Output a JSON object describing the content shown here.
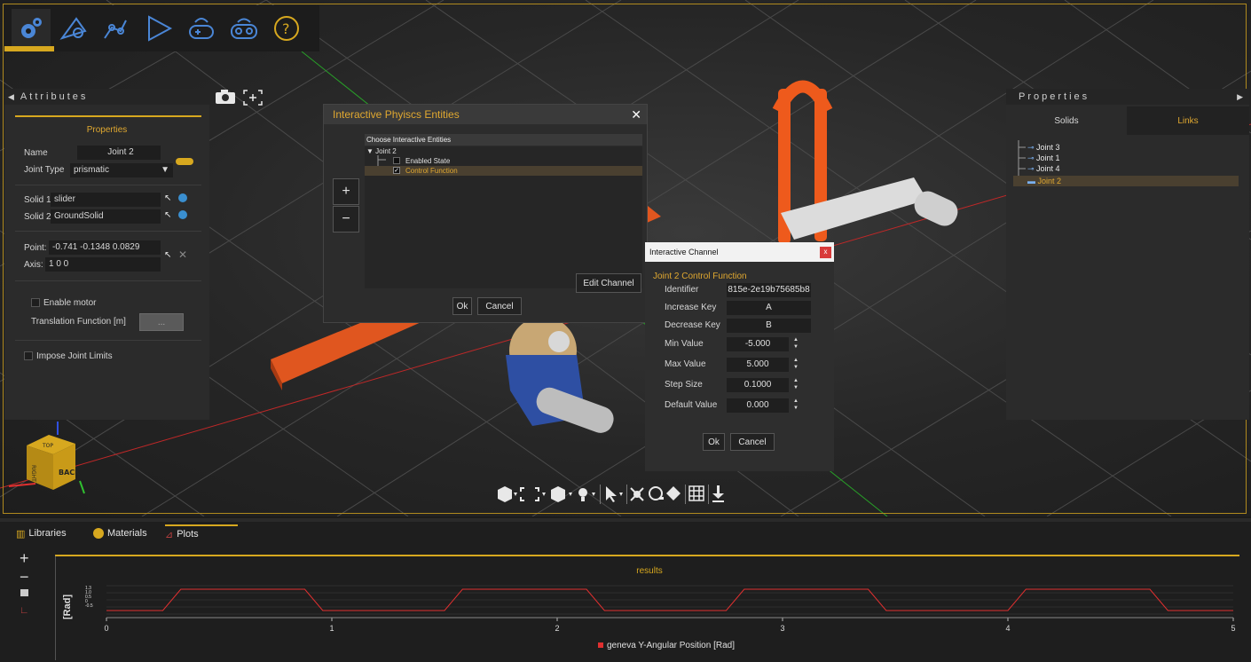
{
  "toolbar": {
    "items": [
      "settings-icon",
      "joint-icon",
      "robot-arm-icon",
      "play-icon",
      "gamepad-icon",
      "vr-controller-icon",
      "help-icon"
    ]
  },
  "attributes": {
    "header": "Attributes",
    "section_title": "Properties",
    "name_label": "Name",
    "name_value": "Joint 2",
    "joint_type_label": "Joint Type",
    "joint_type_value": "prismatic",
    "solid1_label": "Solid 1",
    "solid1_value": "slider",
    "solid2_label": "Solid 2",
    "solid2_value": "GroundSolid",
    "point_label": "Point:",
    "point_value": "-0.741 -0.1348 0.0829",
    "axis_label": "Axis:",
    "axis_value": "1 0 0",
    "enable_motor_label": "Enable motor",
    "translation_function_label": "Translation Function [m]",
    "translation_function_button": "...",
    "impose_limits_label": "Impose Joint Limits"
  },
  "properties": {
    "header": "Properties",
    "tabs": [
      "Solids",
      "Links"
    ],
    "active_tab": "Links",
    "tree": [
      "Joint 3",
      "Joint 1",
      "Joint 4",
      "Joint 2"
    ],
    "selected": "Joint 2"
  },
  "entities_dialog": {
    "title": "Interactive Phyiscs Entities",
    "close": "✕",
    "list_header": "Choose Interactive Entities",
    "root": "Joint 2",
    "children": [
      "Enabled State",
      "Control Function"
    ],
    "add_label": "+",
    "remove_label": "−",
    "edit_channel": "Edit Channel",
    "ok": "Ok",
    "cancel": "Cancel"
  },
  "channel_dialog": {
    "title": "Interactive Channel",
    "close": "x",
    "subtitle": "Joint 2 Control Function",
    "fields": [
      {
        "label": "Identifier",
        "value": "815e-2e19b75685b8"
      },
      {
        "label": "Increase Key",
        "value": "A"
      },
      {
        "label": "Decrease Key",
        "value": "B"
      },
      {
        "label": "Min Value",
        "value": "-5.000"
      },
      {
        "label": "Max Value",
        "value": "5.000"
      },
      {
        "label": "Step Size",
        "value": "0.1000"
      },
      {
        "label": "Default Value",
        "value": "0.000"
      }
    ],
    "ok": "Ok",
    "cancel": "Cancel"
  },
  "view_cube": {
    "top": "TOP",
    "front": "BACK",
    "side": "RIGHT"
  },
  "bottom_tabs": [
    "Libraries",
    "Materials",
    "Plots"
  ],
  "plot": {
    "title": "results",
    "y_axis_label": "[Rad]",
    "y_ticks": [
      "1.3",
      "1.0",
      "0.5",
      "0",
      "-0.5"
    ],
    "x_ticks": [
      "0",
      "1",
      "2",
      "3",
      "4",
      "5"
    ],
    "legend": "geneva Y-Angular Position [Rad]",
    "series_color": "#e03030"
  },
  "chart_data": {
    "type": "line",
    "title": "results",
    "ylabel": "[Rad]",
    "xlim": [
      0,
      5
    ],
    "series": [
      {
        "name": "geneva Y-Angular Position [Rad]",
        "x": [
          0,
          0.25,
          0.33,
          0.88,
          0.96,
          1.5,
          1.58,
          2.13,
          2.21,
          2.75,
          2.83,
          3.38,
          3.46,
          4.0,
          4.08,
          4.63,
          4.71,
          5.0
        ],
        "y": [
          0,
          0,
          1,
          1,
          0,
          0,
          1,
          1,
          0,
          0,
          1,
          1,
          0,
          0,
          1,
          1,
          0,
          0
        ]
      }
    ]
  }
}
